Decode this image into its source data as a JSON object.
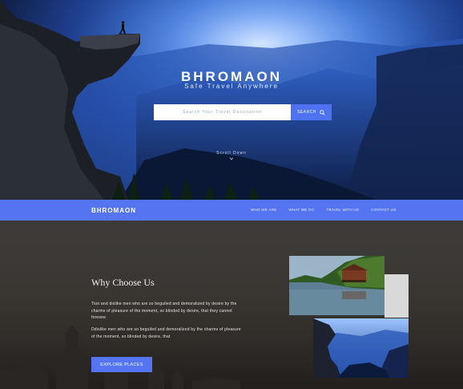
{
  "hero": {
    "title": "BHROMAON",
    "tagline": "Safe Travel Anywhere",
    "search": {
      "placeholder": "Search Your Travel Destination",
      "button_label": "SEARCH"
    },
    "scroll_hint": "Scroll Down"
  },
  "nav": {
    "brand": "BHROMAON",
    "links": [
      {
        "label": "WHO WE ARE"
      },
      {
        "label": "WHAT WE DO"
      },
      {
        "label": "TRAVEL WITH US"
      },
      {
        "label": "CONTACT US"
      }
    ]
  },
  "about": {
    "heading": "Why Choose Us",
    "paragraph_1": "Tion and dislike men who are so beguiled and demoralized by desire by the charms of pleasure of the moment, so blinded by desire, that they cannot foresee",
    "paragraph_2": "Ddislike men who are so beguiled and demoralized by the charms of pleasure of the moment, so blinded by desire, that",
    "cta_label": "EXPLORE PLACES"
  },
  "colors": {
    "accent": "#5574f2",
    "section_dark": "#3d3b3a"
  },
  "icons": {
    "search_button": "search-icon",
    "scroll_hint": "chevron-down-icon"
  }
}
